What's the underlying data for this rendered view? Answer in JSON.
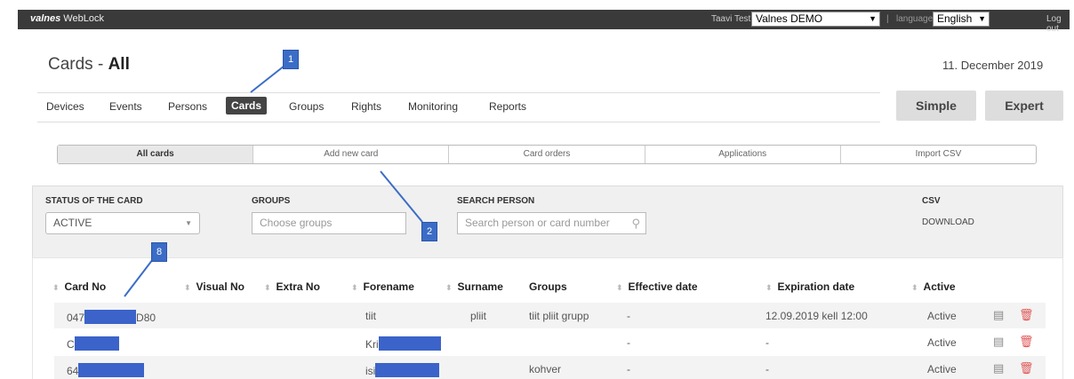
{
  "topbar": {
    "logo_brand": "valnes",
    "logo_product": " WebLock",
    "user": "Taavi Test|",
    "account_select": "Valnes DEMO",
    "separator": "|",
    "language_label": "language",
    "language_select": "English",
    "logout": "Log out"
  },
  "header": {
    "title_prefix": "Cards - ",
    "title_bold": "All",
    "date": "11. December 2019"
  },
  "nav": [
    "Devices",
    "Events",
    "Persons",
    "Cards",
    "Groups",
    "Rights",
    "Monitoring",
    "Reports"
  ],
  "mode_buttons": {
    "simple": "Simple",
    "expert": "Expert"
  },
  "subtabs": [
    "All cards",
    "Add new card",
    "Card orders",
    "Applications",
    "Import CSV"
  ],
  "filters": {
    "status_label": "STATUS OF THE CARD",
    "status_value": "ACTIVE",
    "groups_label": "GROUPS",
    "groups_placeholder": "Choose groups",
    "search_label": "SEARCH PERSON",
    "search_placeholder": "Search person or card number",
    "csv_label": "CSV",
    "csv_download": "DOWNLOAD"
  },
  "table": {
    "columns": [
      "Card No",
      "Visual No",
      "Extra No",
      "Forename",
      "Surname",
      "Groups",
      "Effective date",
      "Expiration date",
      "Active"
    ],
    "rows": [
      {
        "card_prefix": "047",
        "card_suffix": "D80",
        "forename": "tiit",
        "surname": "pliit",
        "groups": "tiit pliit grupp",
        "effective": "-",
        "expiration": "12.09.2019 kell 12:00",
        "active": "Active"
      },
      {
        "card_prefix": "C",
        "card_suffix": "",
        "forename": "Kri",
        "surname": "",
        "groups": "",
        "effective": "-",
        "expiration": "-",
        "active": "Active"
      },
      {
        "card_prefix": "64",
        "card_suffix": "",
        "forename": "isi",
        "surname": "",
        "groups": "kohver",
        "effective": "-",
        "expiration": "-",
        "active": "Active"
      }
    ]
  },
  "callouts": [
    "1",
    "2",
    "8"
  ],
  "icons": {
    "edit": "edit-icon",
    "delete": "trash-icon",
    "search": "search-icon",
    "sort": "sort-icon"
  },
  "colors": {
    "topbar": "#3a3a3a",
    "callout": "#3b6dc7",
    "redaction": "#3b63c9",
    "delete": "#e05555"
  }
}
